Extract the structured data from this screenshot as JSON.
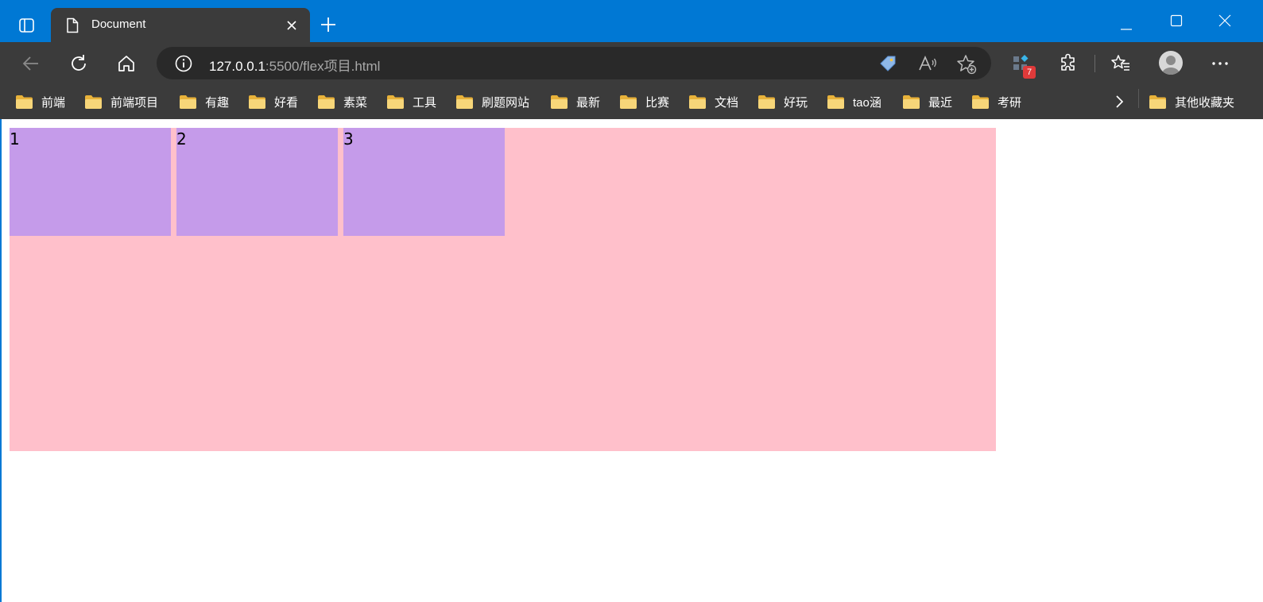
{
  "tab": {
    "title": "Document"
  },
  "address_bar": {
    "host": "127.0.0.1",
    "path": ":5500/flex项目.html"
  },
  "toolbar": {
    "extensions_badge": "7"
  },
  "bookmarks": [
    "前端",
    "前端项目",
    "有趣",
    "好看",
    "素菜",
    "工具",
    "刷题网站",
    "最新",
    "比赛",
    "文档",
    "好玩",
    "tao涵",
    "最近",
    "考研"
  ],
  "other_bookmarks": "其他收藏夹",
  "page": {
    "items": [
      "1",
      "2",
      "3"
    ]
  },
  "colors": {
    "titlebar": "#0078d4",
    "toolbar": "#3b3b3b",
    "container": "#ffc0cb",
    "item": "#c59bea"
  }
}
